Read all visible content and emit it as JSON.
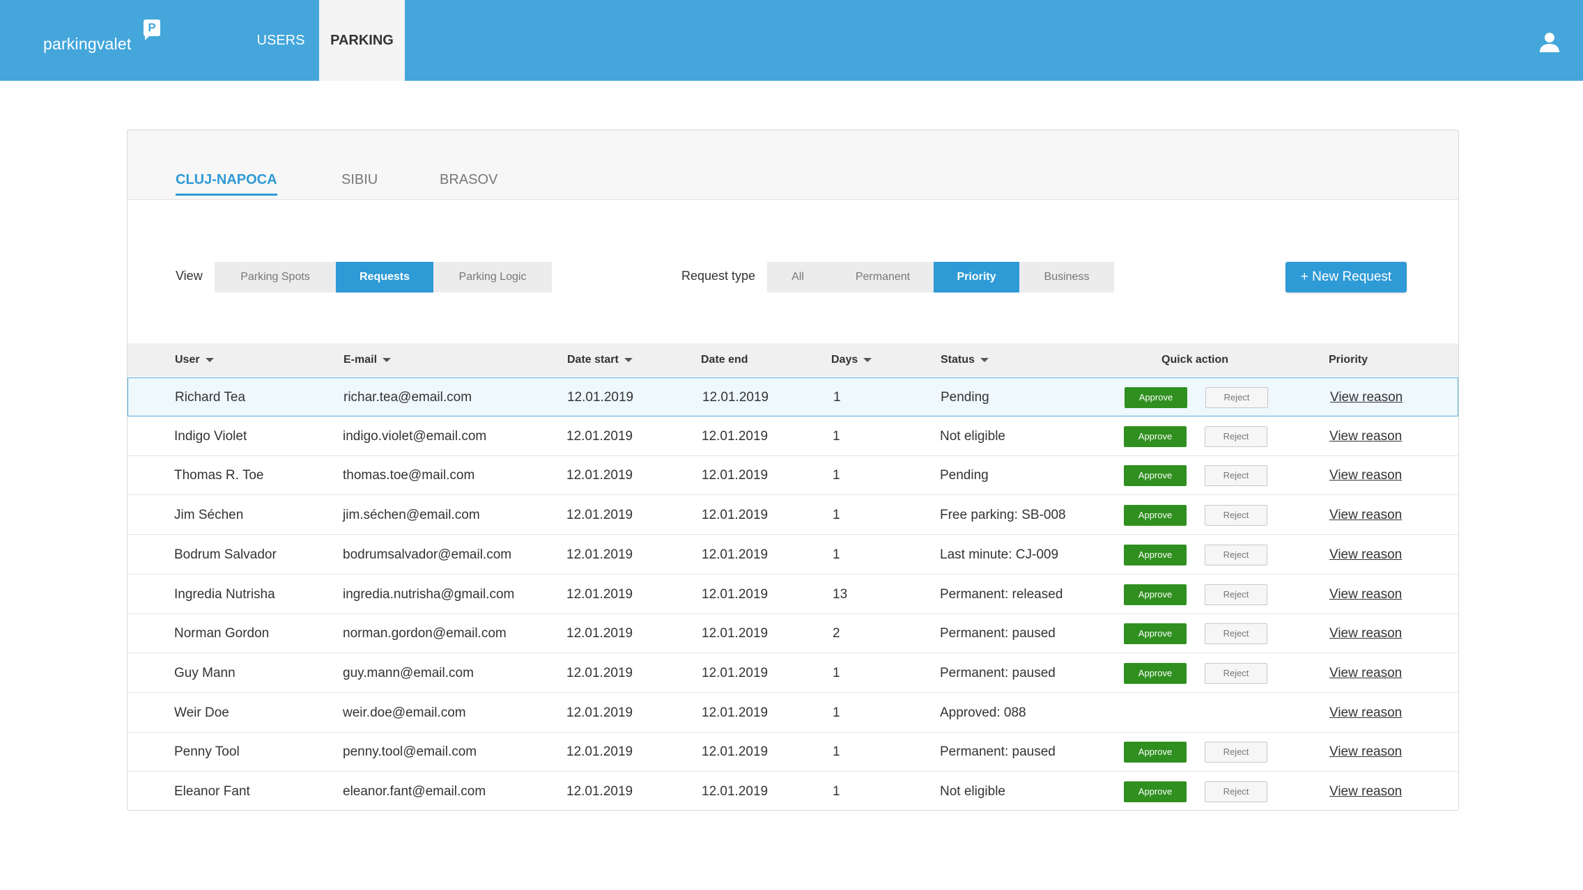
{
  "brand": {
    "name": "parkingvalet",
    "badge": "P"
  },
  "nav": {
    "users": "USERS",
    "parking": "PARKING"
  },
  "cities": [
    "CLUJ-NAPOCA",
    "SIBIU",
    "BRASOV"
  ],
  "filters": {
    "view_label": "View",
    "view_options": [
      "Parking Spots",
      "Requests",
      "Parking Logic"
    ],
    "view_selected": "Requests",
    "request_type_label": "Request type",
    "request_type_options": [
      "All",
      "Permanent",
      "Priority",
      "Business"
    ],
    "request_type_selected": "Priority",
    "new_request": "+ New Request"
  },
  "table": {
    "headers": [
      "User",
      "E-mail",
      "Date start",
      "Date end",
      "Days",
      "Status",
      "Quick action",
      "Priority"
    ],
    "sortable": [
      true,
      true,
      true,
      false,
      true,
      true,
      false,
      false
    ],
    "approve_label": "Approve",
    "reject_label": "Reject",
    "rows": [
      {
        "user": "Richard Tea",
        "email": "richar.tea@email.com",
        "start": "12.01.2019",
        "end": "12.01.2019",
        "days": "1",
        "status": "Pending",
        "actions": true,
        "priority": "View reason"
      },
      {
        "user": "Indigo Violet",
        "email": "indigo.violet@email.com",
        "start": "12.01.2019",
        "end": "12.01.2019",
        "days": "1",
        "status": "Not eligible",
        "actions": true,
        "priority": "View reason"
      },
      {
        "user": "Thomas R. Toe",
        "email": "thomas.toe@mail.com",
        "start": "12.01.2019",
        "end": "12.01.2019",
        "days": "1",
        "status": "Pending",
        "actions": true,
        "priority": "View reason"
      },
      {
        "user": "Jim Séchen",
        "email": "jim.séchen@email.com",
        "start": "12.01.2019",
        "end": "12.01.2019",
        "days": "1",
        "status": "Free parking: SB-008",
        "actions": true,
        "priority": "View reason"
      },
      {
        "user": "Bodrum Salvador",
        "email": "bodrumsalvador@email.com",
        "start": "12.01.2019",
        "end": "12.01.2019",
        "days": "1",
        "status": "Last minute: CJ-009",
        "actions": true,
        "priority": "View reason"
      },
      {
        "user": "Ingredia Nutrisha",
        "email": "ingredia.nutrisha@gmail.com",
        "start": "12.01.2019",
        "end": "12.01.2019",
        "days": "13",
        "status": "Permanent: released",
        "actions": true,
        "priority": "View reason"
      },
      {
        "user": "Norman Gordon",
        "email": "norman.gordon@email.com",
        "start": "12.01.2019",
        "end": "12.01.2019",
        "days": "2",
        "status": "Permanent: paused",
        "actions": true,
        "priority": "View reason"
      },
      {
        "user": "Guy Mann",
        "email": "guy.mann@email.com",
        "start": "12.01.2019",
        "end": "12.01.2019",
        "days": "1",
        "status": "Permanent: paused",
        "actions": true,
        "priority": "View reason"
      },
      {
        "user": "Weir Doe",
        "email": "weir.doe@email.com",
        "start": "12.01.2019",
        "end": "12.01.2019",
        "days": "1",
        "status": "Approved: 088",
        "actions": false,
        "priority": "View reason"
      },
      {
        "user": "Penny Tool",
        "email": "penny.tool@email.com",
        "start": "12.01.2019",
        "end": "12.01.2019",
        "days": "1",
        "status": "Permanent: paused",
        "actions": true,
        "priority": "View reason"
      },
      {
        "user": "Eleanor Fant",
        "email": "eleanor.fant@email.com",
        "start": "12.01.2019",
        "end": "12.01.2019",
        "days": "1",
        "status": "Not eligible",
        "actions": true,
        "priority": "View reason"
      }
    ]
  },
  "colors": {
    "brand_blue": "#44a6db",
    "accent_blue": "#2e9ad6",
    "approve_green": "#2f8f1f"
  },
  "icons": {
    "user": "user-icon",
    "sort": "caret-down-icon"
  }
}
